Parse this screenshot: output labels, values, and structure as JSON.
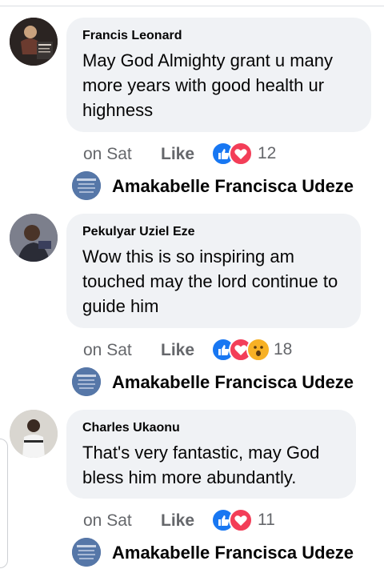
{
  "comments": [
    {
      "author": "Francis Leonard",
      "text": "May God Almighty grant u many more years with good health ur highness",
      "time": "on Sat",
      "like_label": "Like",
      "reactions": [
        "like",
        "love"
      ],
      "reaction_count": "12",
      "reply_author": "Amakabelle Francisca Udeze"
    },
    {
      "author": "Pekulyar Uziel Eze",
      "text": "Wow this is so inspiring am touched may the lord continue to guide him",
      "time": "on Sat",
      "like_label": "Like",
      "reactions": [
        "like",
        "love",
        "wow"
      ],
      "reaction_count": "18",
      "reply_author": "Amakabelle Francisca Udeze"
    },
    {
      "author": "Charles Ukaonu",
      "text": "That's very fantastic, may God bless him more abundantly.",
      "time": "on Sat",
      "like_label": "Like",
      "reactions": [
        "like",
        "love"
      ],
      "reaction_count": "11",
      "reply_author": "Amakabelle Francisca Udeze"
    }
  ]
}
